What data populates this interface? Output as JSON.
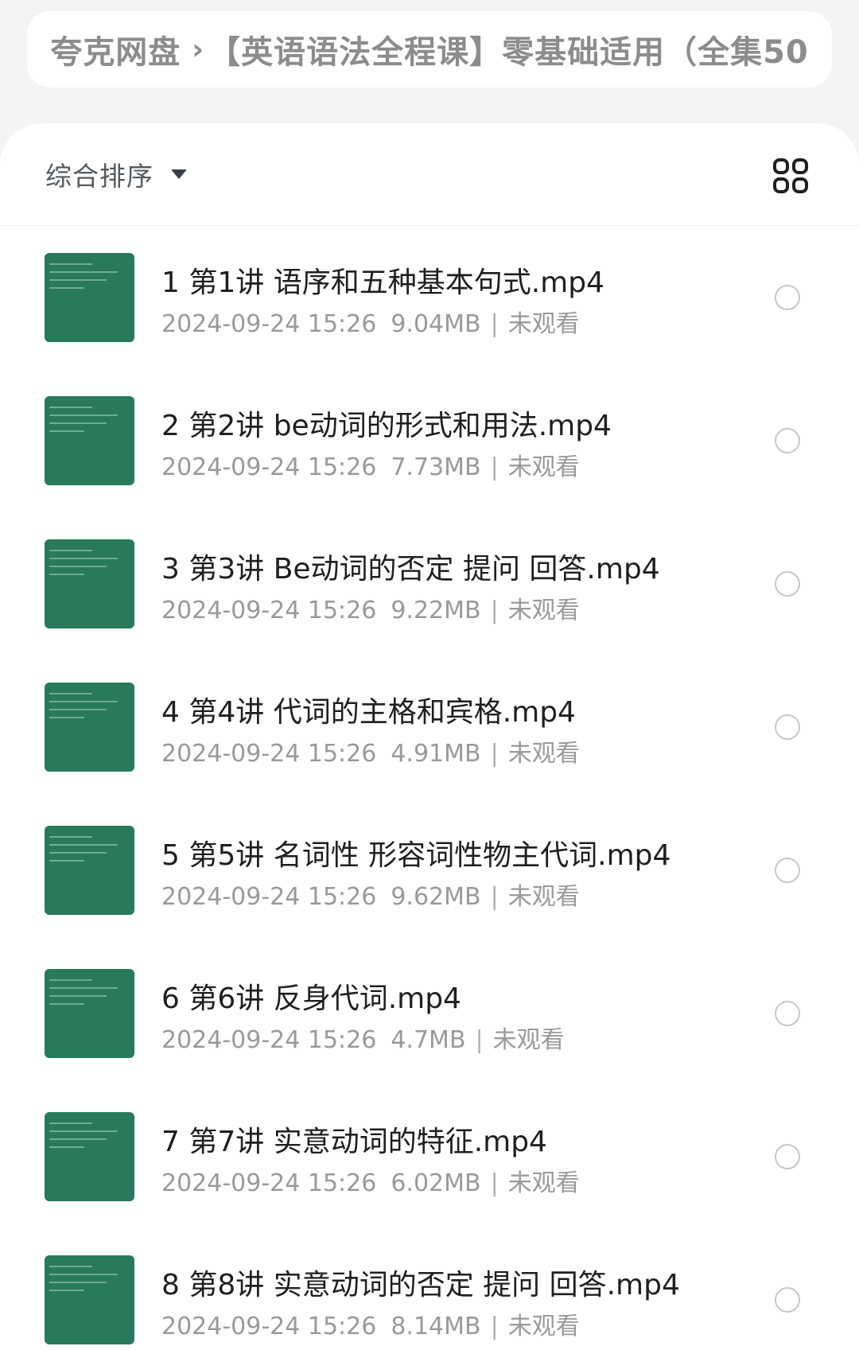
{
  "breadcrumb": {
    "root": "夸克网盘",
    "folder": "【英语语法全程课】零基础适用（全集50"
  },
  "toolbar": {
    "sort_label": "综合排序",
    "sort_icon": "caret-down-icon",
    "view_toggle_icon": "grid-view-icon"
  },
  "colors": {
    "thumbnail_bg": "#287a5a",
    "title_text": "#1f1f1f",
    "meta_text": "#9a9a9a"
  },
  "files": [
    {
      "name": "1 第1讲 语序和五种基本句式.mp4",
      "date": "2024-09-24 15:26",
      "size": "9.04MB",
      "status": "未观看"
    },
    {
      "name": "2 第2讲 be动词的形式和用法.mp4",
      "date": "2024-09-24 15:26",
      "size": "7.73MB",
      "status": "未观看"
    },
    {
      "name": "3 第3讲 Be动词的否定 提问 回答.mp4",
      "date": "2024-09-24 15:26",
      "size": "9.22MB",
      "status": "未观看"
    },
    {
      "name": "4 第4讲 代词的主格和宾格.mp4",
      "date": "2024-09-24 15:26",
      "size": "4.91MB",
      "status": "未观看"
    },
    {
      "name": "5 第5讲 名词性 形容词性物主代词.mp4",
      "date": "2024-09-24 15:26",
      "size": "9.62MB",
      "status": "未观看"
    },
    {
      "name": "6 第6讲 反身代词.mp4",
      "date": "2024-09-24 15:26",
      "size": "4.7MB",
      "status": "未观看"
    },
    {
      "name": "7 第7讲 实意动词的特征.mp4",
      "date": "2024-09-24 15:26",
      "size": "6.02MB",
      "status": "未观看"
    },
    {
      "name": "8 第8讲 实意动词的否定 提问 回答.mp4",
      "date": "2024-09-24 15:26",
      "size": "8.14MB",
      "status": "未观看"
    }
  ]
}
